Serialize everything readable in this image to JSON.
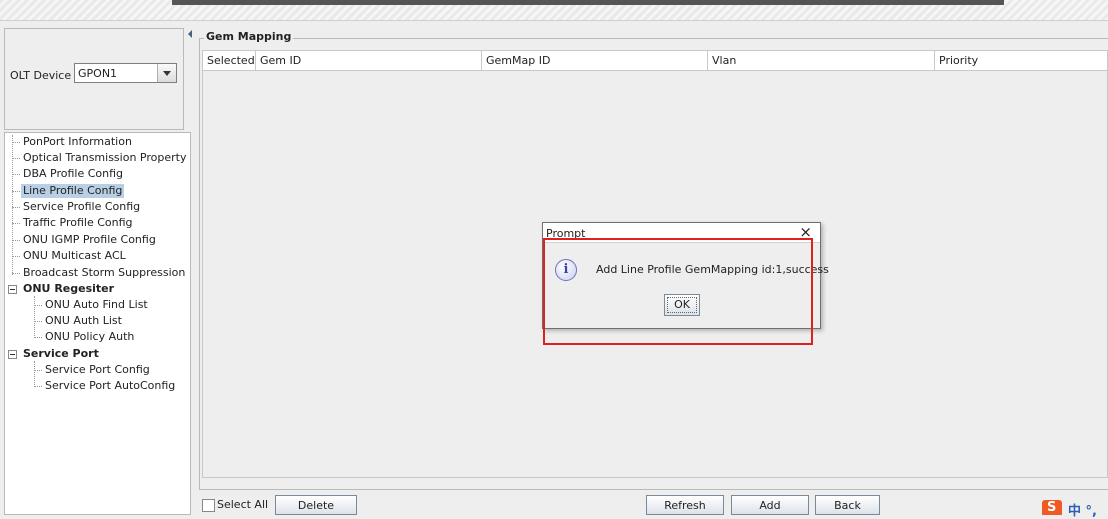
{
  "device": {
    "label": "OLT Device",
    "selected": "GPON1"
  },
  "tree": {
    "items": [
      "PonPort Information",
      "Optical Transmission Property",
      "DBA Profile Config",
      "Line Profile Config",
      "Service Profile Config",
      "Traffic Profile Config",
      "ONU IGMP Profile Config",
      "ONU Multicast ACL",
      "Broadcast Storm Suppression"
    ],
    "onu_register": {
      "label": "ONU Regesiter",
      "items": [
        "ONU Auto Find List",
        "ONU Auth List",
        "ONU Policy Auth"
      ]
    },
    "service_port": {
      "label": "Service Port",
      "items": [
        "Service Port Config",
        "Service Port AutoConfig"
      ]
    }
  },
  "gem_mapping": {
    "title": "Gem Mapping",
    "columns": [
      "Selected",
      "Gem ID",
      "GemMap ID",
      "Vlan",
      "Priority"
    ]
  },
  "footer": {
    "select_all": "Select All",
    "delete": "Delete",
    "refresh": "Refresh",
    "add": "Add",
    "back": "Back"
  },
  "dialog": {
    "title": "Prompt",
    "close": "×",
    "icon": "i",
    "message": "Add Line Profile GemMapping id:1,success",
    "ok": "OK"
  },
  "ime": {
    "text": "中 °,"
  },
  "colors": {
    "selection": "#b8cfe5",
    "highlight": "#e02020",
    "info_icon": "#6b74b8"
  }
}
